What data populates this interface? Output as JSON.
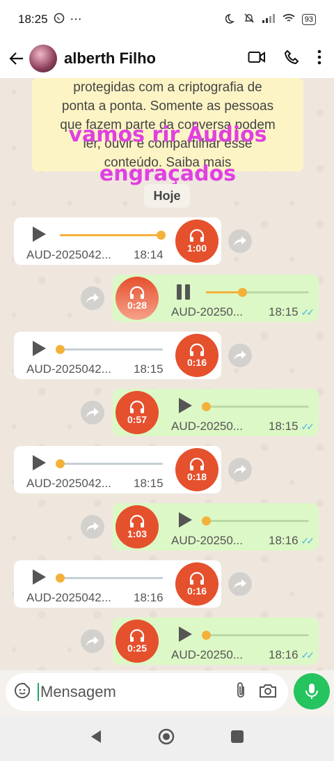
{
  "status": {
    "time": "18:25",
    "extra": "⋯",
    "battery": "93"
  },
  "header": {
    "contact_name": "alberth Filho"
  },
  "encryption": {
    "lines": [
      "protegidas com a criptografia de",
      "ponta a ponta. Somente as pessoas",
      "que fazem parte da conversa podem",
      "ler, ouvir e compartilhar esse",
      "conteúdo. Saiba mais"
    ]
  },
  "overlay_text": {
    "line1": "vamos rir Áudios",
    "line2": "engraçados"
  },
  "date_chip": "Hoje",
  "messages": [
    {
      "dir": "in",
      "file": "AUD-2025042...",
      "time": "18:14",
      "duration": "1:00",
      "progress": 0.98
    },
    {
      "dir": "out",
      "file": "AUD-20250...",
      "time": "18:15",
      "duration": "0:28",
      "progress": 0.35,
      "playing": true
    },
    {
      "dir": "in",
      "file": "AUD-2025042...",
      "time": "18:15",
      "duration": "0:16",
      "progress": 0.0
    },
    {
      "dir": "out",
      "file": "AUD-20250...",
      "time": "18:15",
      "duration": "0:57",
      "progress": 0.0
    },
    {
      "dir": "in",
      "file": "AUD-2025042...",
      "time": "18:15",
      "duration": "0:18",
      "progress": 0.0
    },
    {
      "dir": "out",
      "file": "AUD-20250...",
      "time": "18:16",
      "duration": "1:03",
      "progress": 0.0
    },
    {
      "dir": "in",
      "file": "AUD-2025042...",
      "time": "18:16",
      "duration": "0:16",
      "progress": 0.0
    },
    {
      "dir": "out",
      "file": "AUD-20250...",
      "time": "18:16",
      "duration": "0:25",
      "progress": 0.0
    }
  ],
  "composer": {
    "placeholder": "Mensagem"
  },
  "colors": {
    "accent": "#e5502d",
    "progress": "#f4b13a",
    "outgoing": "#dcf8c6",
    "mic": "#25c45e",
    "overlay": "#e040e0"
  }
}
